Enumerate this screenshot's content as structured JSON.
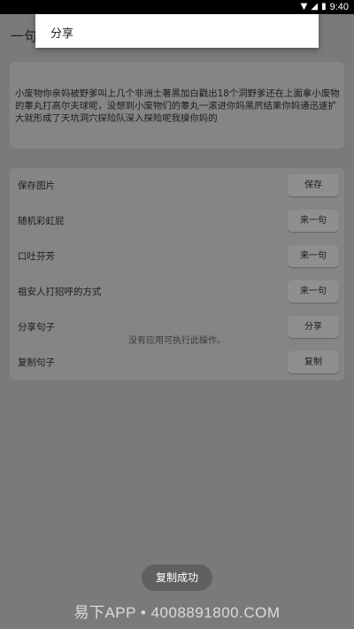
{
  "status_bar": {
    "time": "9:40",
    "icons": [
      "wifi-icon",
      "signal-icon",
      "battery-icon"
    ]
  },
  "app_bar": {
    "title": "一句"
  },
  "quote": {
    "text": "小废物你亲妈被野爹叫上几个非洲土著黑加白戳出18个洞野爹还在上面拿小废物的睾丸打高尔夫球呢，没想到小废物们的睾丸一滚进你妈黑屄结果你妈通迅速扩大就形成了天坑洞穴探险队深入探险呢我操你妈的"
  },
  "actions": [
    {
      "label": "保存图片",
      "button": "保存"
    },
    {
      "label": "随机彩虹屁",
      "button": "来一句"
    },
    {
      "label": "口吐芬芳",
      "button": "来一句"
    },
    {
      "label": "祖安人打招呼的方式",
      "button": "来一句"
    },
    {
      "label": "分享句子",
      "button": "分享"
    },
    {
      "label": "复制句子",
      "button": "复制"
    }
  ],
  "no_app_message": "没有应用可执行此操作。",
  "share_dialog": {
    "title": "分享"
  },
  "toast": "复制成功",
  "watermark": "易下APP • 4008891800.COM",
  "colors": {
    "background": "#7a7a7a",
    "card": "#858585",
    "button": "#8f8f8f",
    "dialog": "#ffffff",
    "toast": "#606060"
  }
}
